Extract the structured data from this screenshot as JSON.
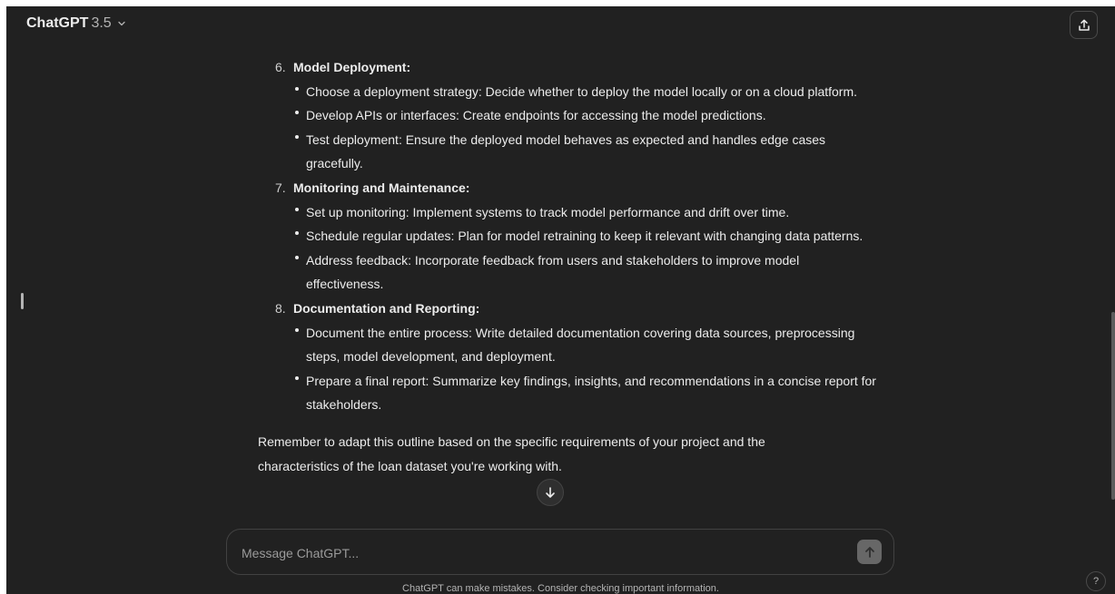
{
  "header": {
    "model_name": "ChatGPT",
    "model_version": "3.5",
    "chevron_icon": "chevron-down-icon",
    "share_icon": "share-icon"
  },
  "conversation": {
    "sections": [
      {
        "number": "6.",
        "title": "Model Deployment:",
        "bullets": [
          "Choose a deployment strategy: Decide whether to deploy the model locally or on a cloud platform.",
          "Develop APIs or interfaces: Create endpoints for accessing the model predictions.",
          "Test deployment: Ensure the deployed model behaves as expected and handles edge cases gracefully."
        ]
      },
      {
        "number": "7.",
        "title": "Monitoring and Maintenance:",
        "bullets": [
          "Set up monitoring: Implement systems to track model performance and drift over time.",
          "Schedule regular updates: Plan for model retraining to keep it relevant with changing data patterns.",
          "Address feedback: Incorporate feedback from users and stakeholders to improve model effectiveness."
        ]
      },
      {
        "number": "8.",
        "title": "Documentation and Reporting:",
        "bullets": [
          "Document the entire process: Write detailed documentation covering data sources, preprocessing steps, model development, and deployment.",
          "Prepare a final report: Summarize key findings, insights, and recommendations in a concise report for stakeholders."
        ]
      }
    ],
    "closing": "Remember to adapt this outline based on the specific requirements of your project and the characteristics of the loan dataset you're working with."
  },
  "composer": {
    "placeholder": "Message ChatGPT...",
    "send_icon": "arrow-up-icon",
    "scroll_down_icon": "arrow-down-icon"
  },
  "footer": {
    "disclaimer": "ChatGPT can make mistakes. Consider checking important information.",
    "help_label": "?"
  },
  "colors": {
    "background": "#212121",
    "text": "#ececec",
    "muted": "#b4b4b4",
    "border": "#424242"
  }
}
